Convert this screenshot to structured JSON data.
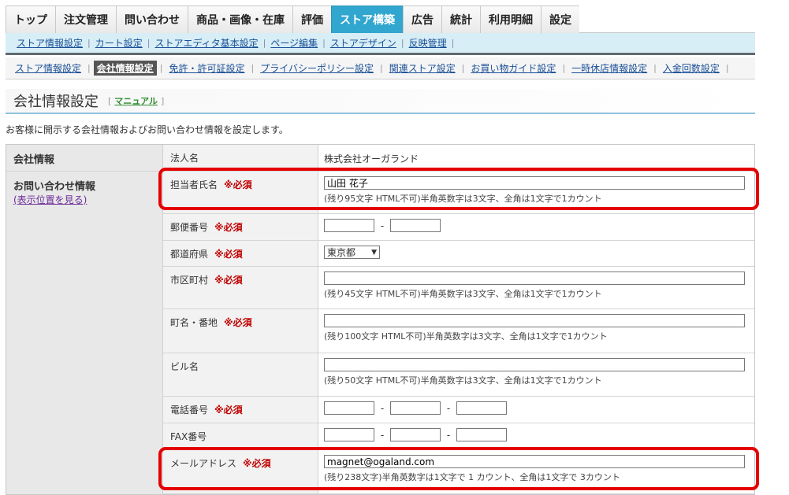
{
  "top_tabs": [
    "トップ",
    "注文管理",
    "問い合わせ",
    "商品・画像・在庫",
    "評価",
    "ストア構築",
    "広告",
    "統計",
    "利用明細",
    "設定"
  ],
  "top_active": "ストア構築",
  "subnav2": [
    "ストア情報設定",
    "カート設定",
    "ストアエディタ基本設定",
    "ページ編集",
    "ストアデザイン",
    "反映管理"
  ],
  "subnav3": [
    "ストア情報設定",
    "会社情報設定",
    "免許・許可証設定",
    "プライバシーポリシー設定",
    "関連ストア設定",
    "お買い物ガイド設定",
    "一時休店情報設定",
    "入金回数設定"
  ],
  "subnav3_active": "会社情報設定",
  "page": {
    "title": "会社情報設定",
    "manual": "マニュアル",
    "description": "お客様に開示する会社情報およびお問い合わせ情報を設定します。"
  },
  "form": {
    "company_info": "会社情報",
    "corp_name_label": "法人名",
    "corp_name_value": "株式会社オーガランド",
    "contact_info": "お問い合わせ情報",
    "view_position": "(表示位置を見る)",
    "required": "※必須",
    "person_label": "担当者氏名",
    "person_value": "山田 花子",
    "person_hint": "(残り95文字 HTML不可)半角英数字は3文字、全角は1文字で1カウント",
    "zip_label": "郵便番号",
    "pref_label": "都道府県",
    "pref_value": "東京都",
    "city_label": "市区町村",
    "city_hint": "(残り45文字 HTML不可)半角英数字は3文字、全角は1文字で1カウント",
    "town_label": "町名・番地",
    "town_hint": "(残り100文字 HTML不可)半角英数字は3文字、全角は1文字で1カウント",
    "bldg_label": "ビル名",
    "bldg_hint": "(残り50文字 HTML不可)半角英数字は3文字、全角は1文字で1カウント",
    "tel_label": "電話番号",
    "fax_label": "FAX番号",
    "mail_label": "メールアドレス",
    "mail_value": "magnet@ogaland.com",
    "mail_hint": "(残り238文字)半角英数字は1文字で 1 カウント、全角は1文字で 3カウント",
    "dash": "-"
  },
  "colors": {
    "accent": "#31a6cf",
    "required": "#c00000",
    "highlight": "#e40000"
  }
}
